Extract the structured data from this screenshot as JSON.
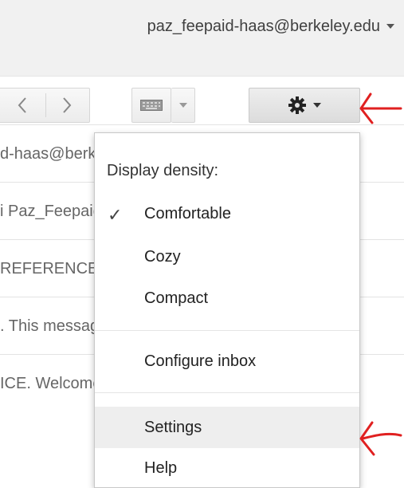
{
  "header": {
    "account_email": "paz_feepaid-haas@berkeley.edu"
  },
  "email_rows": [
    {
      "snippet": "d-haas@berkeley"
    },
    {
      "snippet": "i Paz_Feepaid"
    },
    {
      "snippet": "REFERENCE"
    },
    {
      "snippet": ". This message"
    },
    {
      "snippet": "ICE. Welcome"
    }
  ],
  "settings_menu": {
    "heading": "Display density:",
    "density_options": [
      {
        "label": "Comfortable",
        "checked": true
      },
      {
        "label": "Cozy",
        "checked": false
      },
      {
        "label": "Compact",
        "checked": false
      }
    ],
    "configure_inbox": "Configure inbox",
    "settings": "Settings",
    "help": "Help",
    "check_glyph": "✓"
  },
  "icons": {
    "prev": "chevron-left-icon",
    "next": "chevron-right-icon",
    "keyboard": "keyboard-icon",
    "gear": "gear-icon"
  },
  "colors": {
    "annotation_arrow": "#e02020",
    "hover_bg": "#eeeeee"
  }
}
